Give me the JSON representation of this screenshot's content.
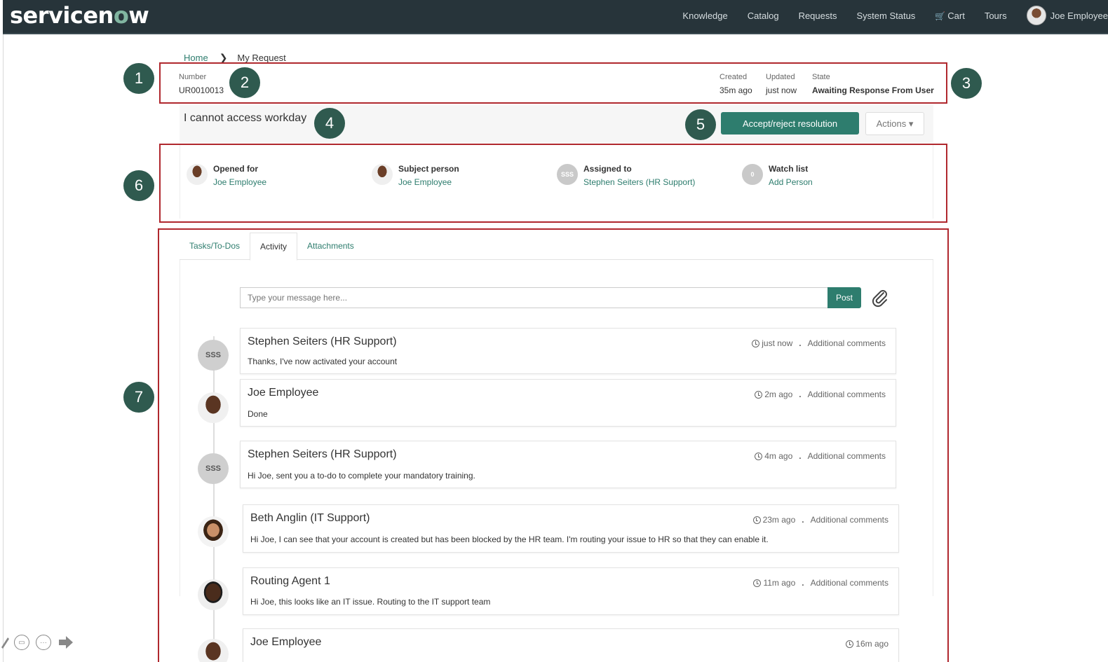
{
  "nav": {
    "logo_pre": "servicen",
    "logo_o": "o",
    "logo_post": "w",
    "links": [
      "Knowledge",
      "Catalog",
      "Requests",
      "System Status",
      "Cart",
      "Tours"
    ],
    "user": "Joe Employee"
  },
  "breadcrumb": {
    "home": "Home",
    "current": "My Request"
  },
  "badges": [
    "1",
    "2",
    "3",
    "4",
    "5",
    "6",
    "7"
  ],
  "header": {
    "number_label": "Number",
    "number_value": "UR0010013",
    "created_label": "Created",
    "created_value": "35m ago",
    "updated_label": "Updated",
    "updated_value": "just now",
    "state_label": "State",
    "state_value": "Awaiting Response From User"
  },
  "request": {
    "title": "I cannot access workday",
    "accept_label": "Accept/reject resolution",
    "actions_label": "Actions ▾"
  },
  "people": [
    {
      "label": "Opened for",
      "value": "Joe Employee",
      "avatar": ""
    },
    {
      "label": "Subject person",
      "value": "Joe Employee",
      "avatar": ""
    },
    {
      "label": "Assigned to",
      "value": "Stephen Seiters (HR Support)",
      "avatar": "SSS"
    },
    {
      "label": "Watch list",
      "value": "Add Person",
      "avatar": "0"
    }
  ],
  "tabs": [
    "Tasks/To-Dos",
    "Activity",
    "Attachments"
  ],
  "composer": {
    "placeholder": "Type your message here...",
    "post_label": "Post"
  },
  "feed": [
    {
      "name": "Stephen Seiters (HR Support)",
      "avatar": "SSS",
      "time": "just now",
      "type": "Additional comments",
      "text": "Thanks, I've now activated your account"
    },
    {
      "name": "Joe Employee",
      "avatar": "",
      "time": "2m ago",
      "type": "Additional comments",
      "text": "Done"
    },
    {
      "name": "Stephen Seiters (HR Support)",
      "avatar": "SSS",
      "time": "4m ago",
      "type": "Additional comments",
      "text": "Hi Joe, sent you a to-do to complete your mandatory training."
    },
    {
      "name": "Beth Anglin (IT Support)",
      "avatar": "",
      "time": "23m ago",
      "type": "Additional comments",
      "text": "Hi Joe, I can see that your account is created but has been blocked by the HR team. I'm routing your issue to HR so that they can enable it."
    },
    {
      "name": "Routing Agent 1",
      "avatar": "",
      "time": "11m ago",
      "type": "Additional comments",
      "text": "Hi Joe, this looks like an IT issue. Routing to the IT support team"
    },
    {
      "name": "Joe Employee",
      "avatar": "",
      "time": "16m ago",
      "type": "",
      "text": ""
    }
  ],
  "colors": {
    "navbar": "#27343a",
    "accent": "#2e7d6e",
    "annotation": "#b0282e",
    "badge": "#2f5a4f"
  }
}
